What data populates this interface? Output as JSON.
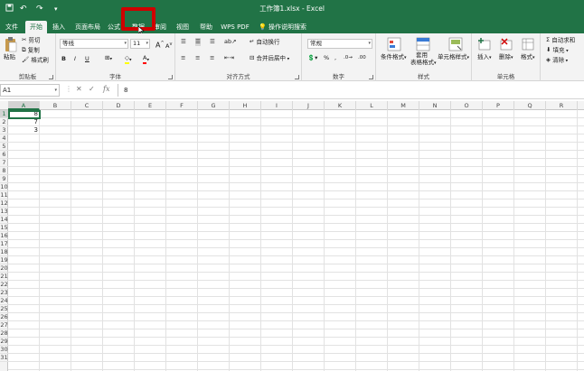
{
  "window": {
    "title": "工作簿1.xlsx - Excel"
  },
  "tabs": [
    "文件",
    "开始",
    "插入",
    "页面布局",
    "公式",
    "数据",
    "审阅",
    "视图",
    "帮助",
    "WPS PDF"
  ],
  "active_tab": "开始",
  "tell_me": "操作说明搜索",
  "clipboard": {
    "paste": "粘贴",
    "cut": "剪切",
    "copy": "复制",
    "format_painter": "格式刷",
    "label": "剪贴板"
  },
  "font": {
    "name": "等线",
    "size": "11",
    "bold": "B",
    "italic": "I",
    "underline": "U",
    "grow": "A",
    "shrink": "A",
    "label": "字体"
  },
  "alignment": {
    "wrap": "自动换行",
    "merge": "合并后居中",
    "label": "对齐方式"
  },
  "number": {
    "format": "常规",
    "label": "数字"
  },
  "styles": {
    "conditional": "条件格式",
    "table_format_1": "套用",
    "table_format_2": "表格格式",
    "cell_styles": "单元格样式",
    "label": "样式"
  },
  "cells_group": {
    "insert": "插入",
    "delete": "删除",
    "format": "格式",
    "label": "单元格"
  },
  "editing": {
    "autosum": "自动求和",
    "fill": "填充",
    "clear": "清除"
  },
  "formula_bar": {
    "name_box": "A1",
    "content": "8",
    "cancel": "✕",
    "enter": "✓",
    "fx": "fx"
  },
  "columns": [
    "A",
    "B",
    "C",
    "D",
    "E",
    "F",
    "G",
    "H",
    "I",
    "J",
    "K",
    "L",
    "M",
    "N",
    "O",
    "P",
    "Q",
    "R"
  ],
  "rows": [
    "1",
    "2",
    "3",
    "4",
    "5",
    "6",
    "7",
    "8",
    "9",
    "10",
    "11",
    "12",
    "13",
    "14",
    "15",
    "16",
    "17",
    "18",
    "19",
    "20",
    "21",
    "22",
    "23",
    "24",
    "25",
    "26",
    "27",
    "28",
    "29",
    "30",
    "31"
  ],
  "cell_values": {
    "A1": "8",
    "A2": "7",
    "A3": "3"
  },
  "colors": {
    "accent": "#217346",
    "highlight": "#d00000"
  }
}
